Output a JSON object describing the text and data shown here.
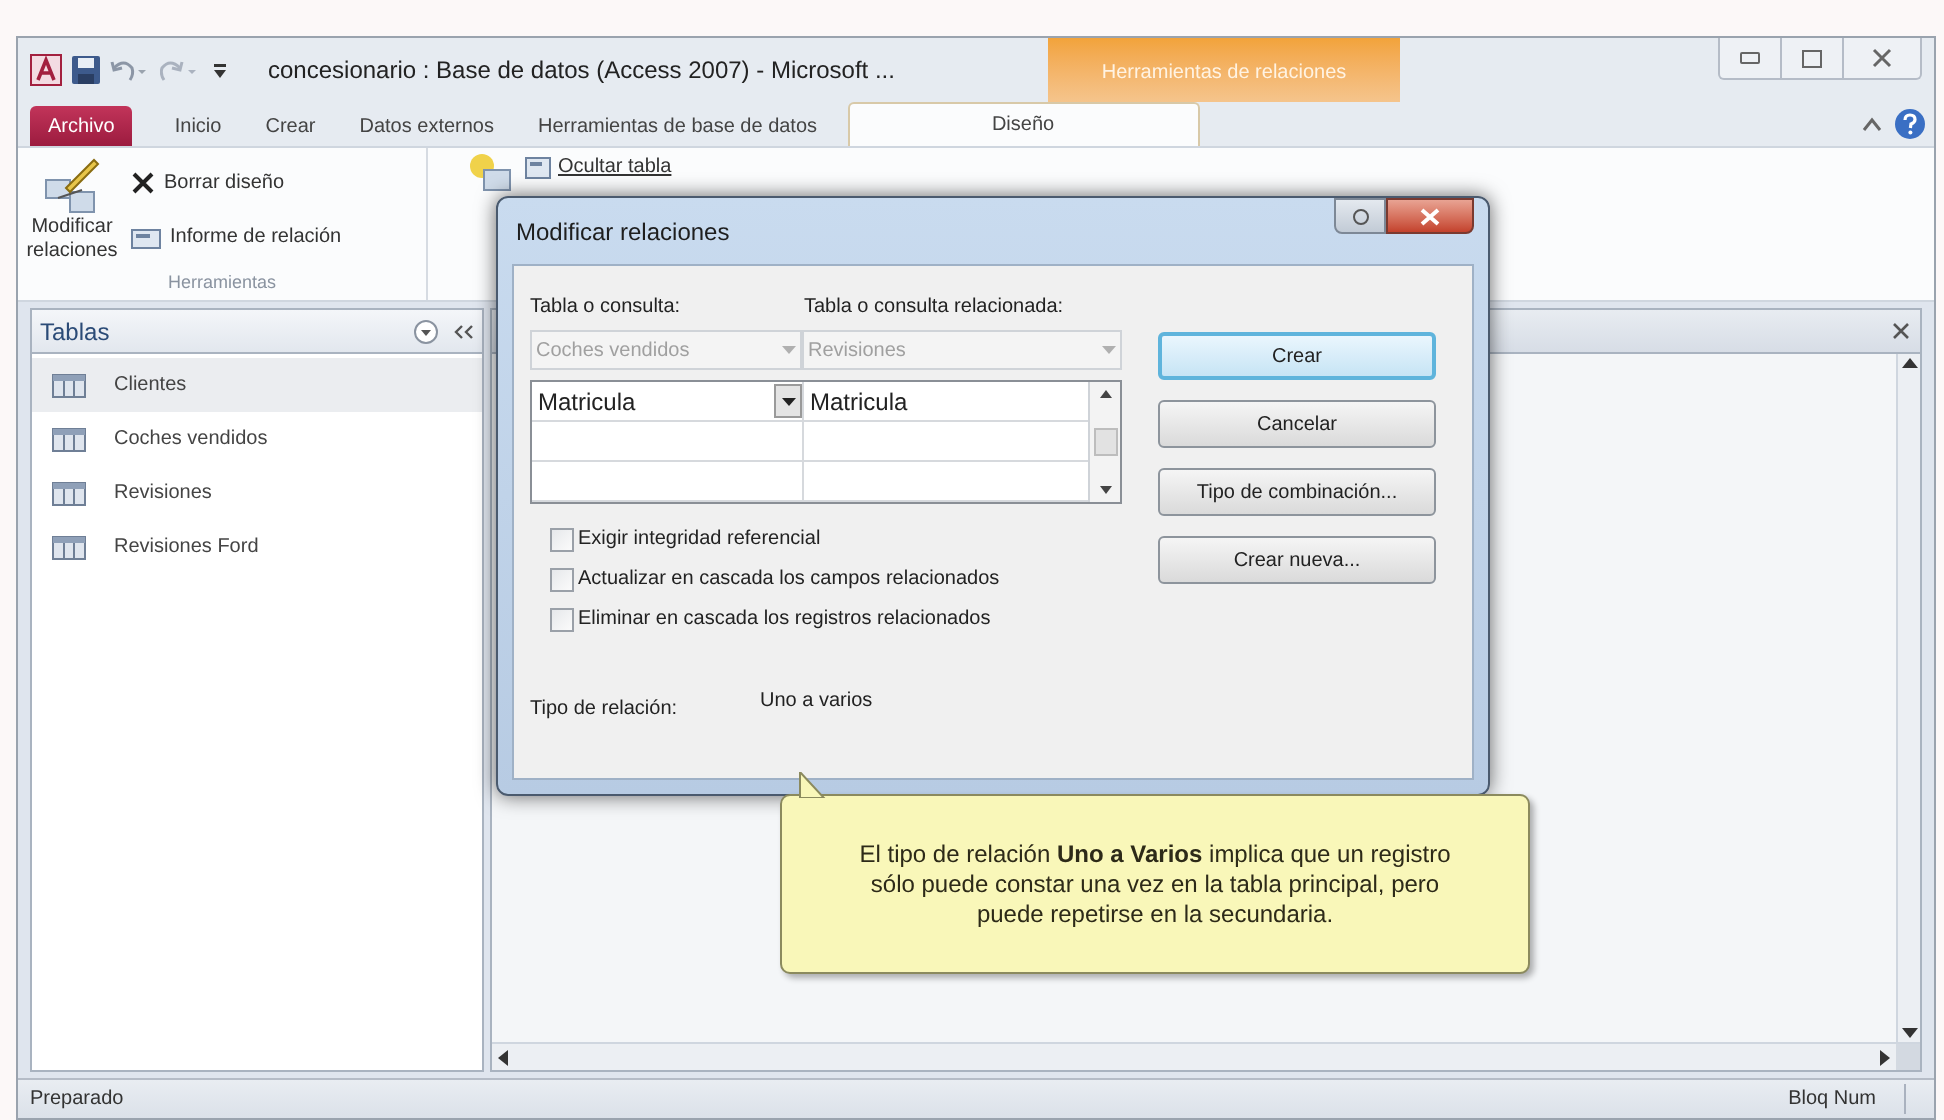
{
  "window": {
    "title": "concesionario : Base de datos (Access 2007)  -  Microsoft ...",
    "contextual_group": "Herramientas de relaciones"
  },
  "ribbon_tabs": [
    {
      "label": "Archivo",
      "kind": "file",
      "selected": false
    },
    {
      "label": "Inicio",
      "kind": "tab",
      "selected": false
    },
    {
      "label": "Crear",
      "kind": "tab",
      "selected": false
    },
    {
      "label": "Datos externos",
      "kind": "tab",
      "selected": false
    },
    {
      "label": "Herramientas de base de datos",
      "kind": "tab",
      "selected": false
    },
    {
      "label": "Diseño",
      "kind": "contextual",
      "selected": true
    }
  ],
  "ribbon": {
    "edit_relationships": "Modificar relaciones",
    "clear_layout": "Borrar diseño",
    "relationship_report": "Informe de relación",
    "group_label": "Herramientas",
    "hide_table": "Ocultar tabla"
  },
  "nav_pane": {
    "title": "Tablas",
    "items": [
      {
        "label": "Clientes",
        "selected": true
      },
      {
        "label": "Coches vendidos",
        "selected": false
      },
      {
        "label": "Revisiones",
        "selected": false
      },
      {
        "label": "Revisiones Ford",
        "selected": false
      }
    ]
  },
  "dialog": {
    "title": "Modificar relaciones",
    "table_label": "Tabla o consulta:",
    "related_label": "Tabla o consulta relacionada:",
    "table": "Coches vendidos",
    "related_table": "Revisiones",
    "fields": [
      {
        "field": "Matricula",
        "related_field": "Matricula"
      }
    ],
    "options": [
      {
        "label": "Exigir integridad referencial",
        "checked": false
      },
      {
        "label": "Actualizar en cascada los campos relacionados",
        "checked": false
      },
      {
        "label": "Eliminar en cascada los registros relacionados",
        "checked": false
      }
    ],
    "relation_type_label": "Tipo de relación:",
    "relation_type": "Uno a varios",
    "buttons": [
      {
        "label": "Crear",
        "default": true
      },
      {
        "label": "Cancelar",
        "default": false
      },
      {
        "label": "Tipo de combinación...",
        "default": false
      },
      {
        "label": "Crear nueva...",
        "default": false
      }
    ]
  },
  "callout": "El tipo de relación **Uno a Varios** implica que un registro sólo puede constar una vez en la tabla principal, pero puede repetirse en la secundaria.",
  "status_bar": {
    "left": "Preparado",
    "right": "Bloq Num"
  }
}
